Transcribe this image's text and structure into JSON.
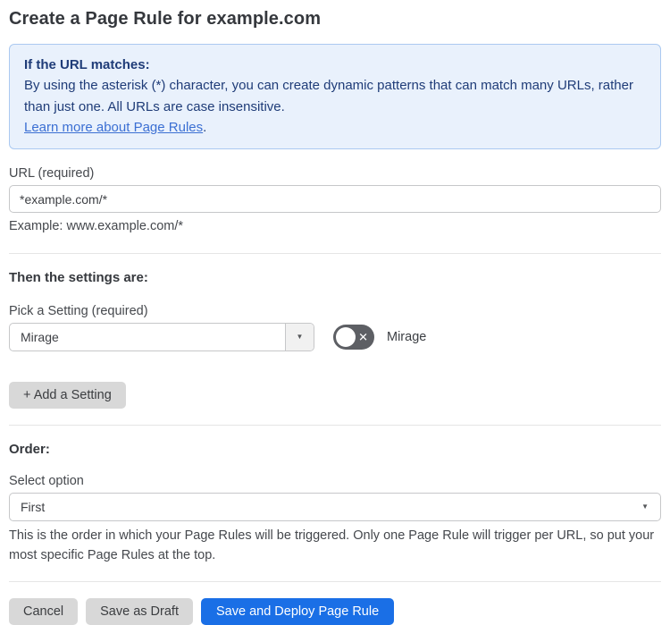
{
  "page": {
    "title": "Create a Page Rule for example.com"
  },
  "info_box": {
    "heading": "If the URL matches:",
    "body": "By using the asterisk (*) character, you can create dynamic patterns that can match many URLs, rather than just one. All URLs are case insensitive.",
    "link_label": "Learn more about Page Rules",
    "link_suffix": "."
  },
  "url_field": {
    "label": "URL (required)",
    "value": "*example.com/*",
    "helper": "Example: www.example.com/*"
  },
  "settings_section": {
    "heading": "Then the settings are:",
    "setting_label": "Pick a Setting (required)",
    "setting_value": "Mirage",
    "toggle_label": "Mirage",
    "toggle_state": "off",
    "add_setting_label": "+ Add a Setting"
  },
  "order_section": {
    "heading": "Order:",
    "select_label": "Select option",
    "select_value": "First",
    "helper": "This is the order in which your Page Rules will be triggered. Only one Page Rule will trigger per URL, so put your most specific Page Rules at the top."
  },
  "actions": {
    "cancel_label": "Cancel",
    "save_draft_label": "Save as Draft",
    "save_deploy_label": "Save and Deploy Page Rule"
  },
  "icons": {
    "dropdown_arrow": "▼",
    "toggle_off_x": "✕"
  },
  "colors": {
    "primary_button": "#1a6fe6",
    "info_box_bg": "#e9f1fc",
    "info_box_border": "#abc9f1",
    "info_text": "#1f3c78",
    "link": "#3b6fd3",
    "toggle_off_bg": "#5d5f64",
    "gray_button_bg": "#d8d8d8"
  }
}
